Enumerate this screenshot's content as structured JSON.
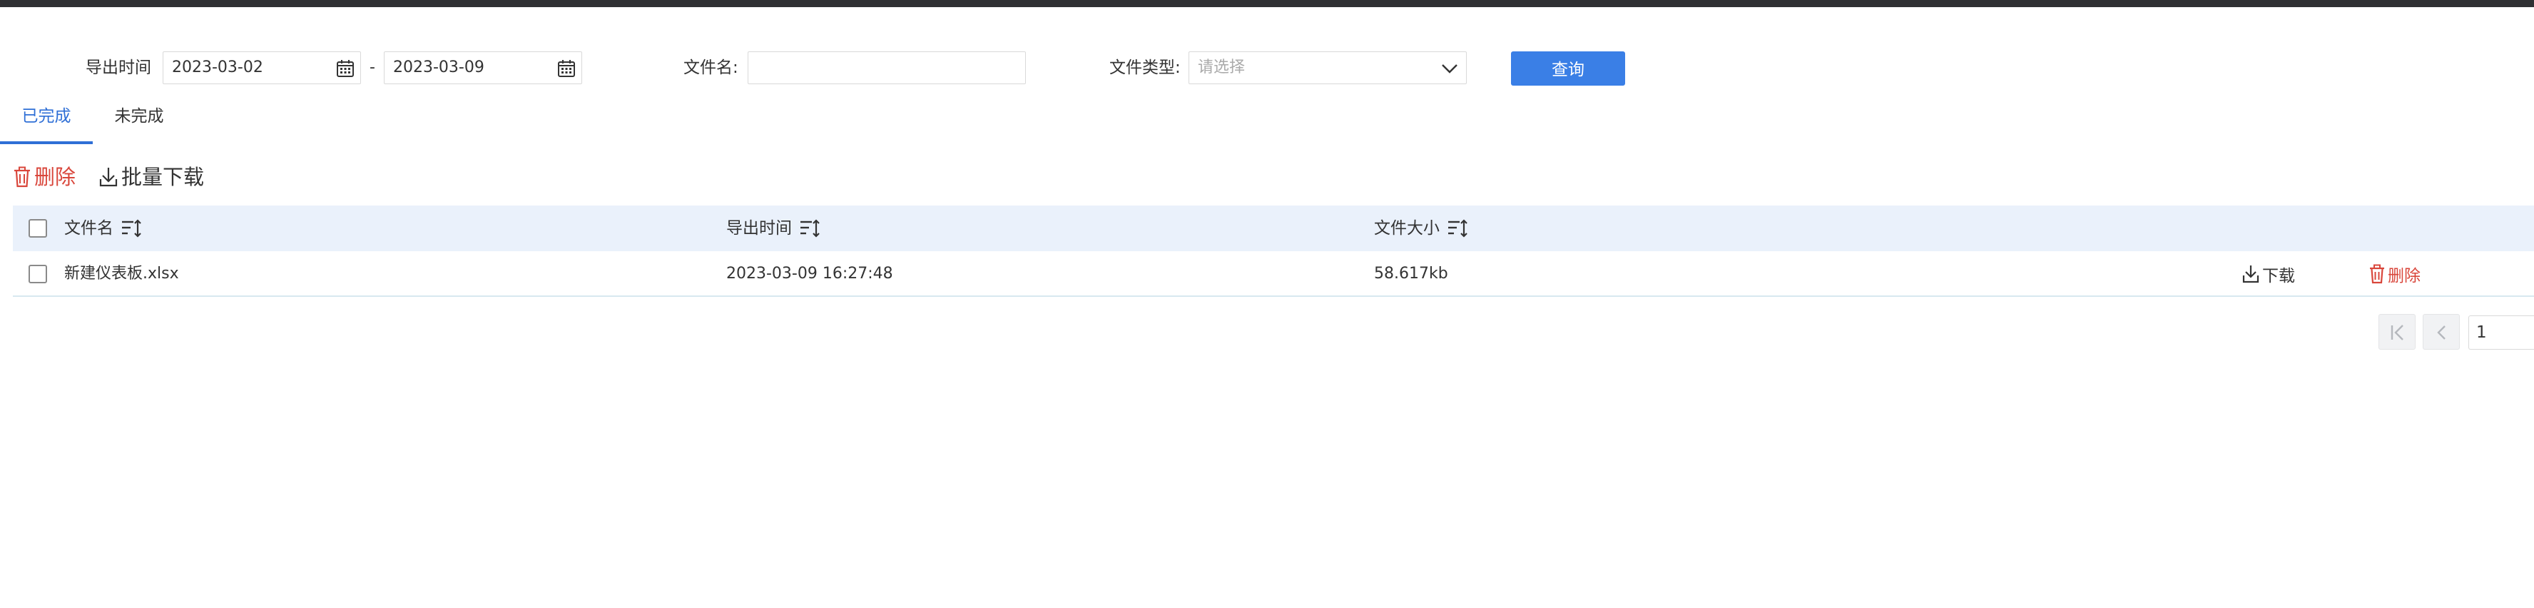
{
  "filters": {
    "export_time_label": "导出时间",
    "start_date": "2023-03-02",
    "date_separator": "-",
    "end_date": "2023-03-09",
    "filename_label": "文件名:",
    "filename_value": "",
    "filetype_label": "文件类型:",
    "filetype_placeholder": "请选择",
    "query_button": "查询"
  },
  "tabs": [
    {
      "label": "已完成",
      "active": true
    },
    {
      "label": "未完成",
      "active": false
    }
  ],
  "toolbar": {
    "delete_label": "删除",
    "batch_download_label": "批量下载"
  },
  "table": {
    "columns": [
      "文件名",
      "导出时间",
      "文件大小"
    ],
    "rows": [
      {
        "filename": "新建仪表板.xlsx",
        "export_time": "2023-03-09 16:27:48",
        "size": "58.617kb",
        "download_label": "下载",
        "delete_label": "删除"
      }
    ]
  },
  "pagination": {
    "current_page": "1"
  },
  "colors": {
    "primary": "#3a7fe6",
    "tab_active": "#2f6fd6",
    "danger": "#d9463b",
    "header_bg": "#eaf1fb",
    "topbar": "#2f3033"
  }
}
